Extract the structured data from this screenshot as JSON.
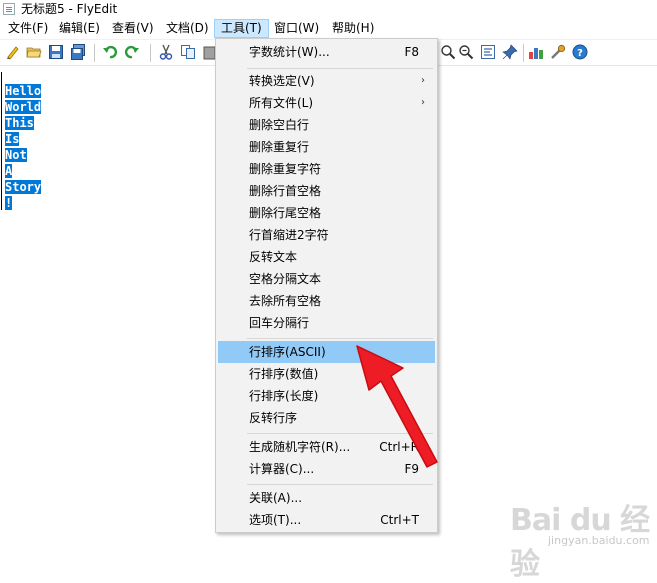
{
  "window": {
    "title": "无标题5 - FlyEdit"
  },
  "menubar": [
    {
      "label": "文件(F)"
    },
    {
      "label": "编辑(E)"
    },
    {
      "label": "查看(V)"
    },
    {
      "label": "文档(D)"
    },
    {
      "label": "工具(T)"
    },
    {
      "label": "窗口(W)"
    },
    {
      "label": "帮助(H)"
    }
  ],
  "active_menu": "工具(T)",
  "toolbar": {
    "buttons": [
      "new-file-icon",
      "open-folder-icon",
      "save-icon",
      "save-all-icon",
      "undo-icon",
      "redo-icon",
      "cut-icon",
      "copy-icon",
      "paste-icon",
      "zoom-in-icon",
      "zoom-out-icon",
      "wrap-icon",
      "pin-icon",
      "stats-chart-icon",
      "tools-icon",
      "help-icon"
    ]
  },
  "editor": {
    "lines": [
      "Hello",
      "World",
      "This",
      "Is",
      "Not",
      "A",
      "Story",
      "!"
    ],
    "selection_color": "#0078d7"
  },
  "tools_menu": {
    "groups": [
      [
        {
          "label": "字数统计(W)...",
          "shortcut": "F8"
        }
      ],
      [
        {
          "label": "转换选定(V)",
          "submenu": true
        },
        {
          "label": "所有文件(L)",
          "submenu": true
        },
        {
          "label": "删除空白行"
        },
        {
          "label": "删除重复行"
        },
        {
          "label": "删除重复字符"
        },
        {
          "label": "删除行首空格"
        },
        {
          "label": "删除行尾空格"
        },
        {
          "label": "行首缩进2字符"
        },
        {
          "label": "反转文本"
        },
        {
          "label": "空格分隔文本"
        },
        {
          "label": "去除所有空格"
        },
        {
          "label": "回车分隔行"
        }
      ],
      [
        {
          "label": "行排序(ASCII)",
          "highlighted": true
        },
        {
          "label": "行排序(数值)"
        },
        {
          "label": "行排序(长度)"
        },
        {
          "label": "反转行序"
        }
      ],
      [
        {
          "label": "生成随机字符(R)...",
          "shortcut": "Ctrl+R"
        },
        {
          "label": "计算器(C)...",
          "shortcut": "F9"
        }
      ],
      [
        {
          "label": "关联(A)..."
        },
        {
          "label": "选项(T)...",
          "shortcut": "Ctrl+T"
        }
      ]
    ],
    "highlight_color": "#91c9f7"
  },
  "annotation": {
    "arrow_color": "#ee1c24",
    "arrow_target": "行排序(ASCII)"
  },
  "watermark": {
    "text": "Bai du 经验",
    "sub": "jingyan.baidu.com"
  }
}
